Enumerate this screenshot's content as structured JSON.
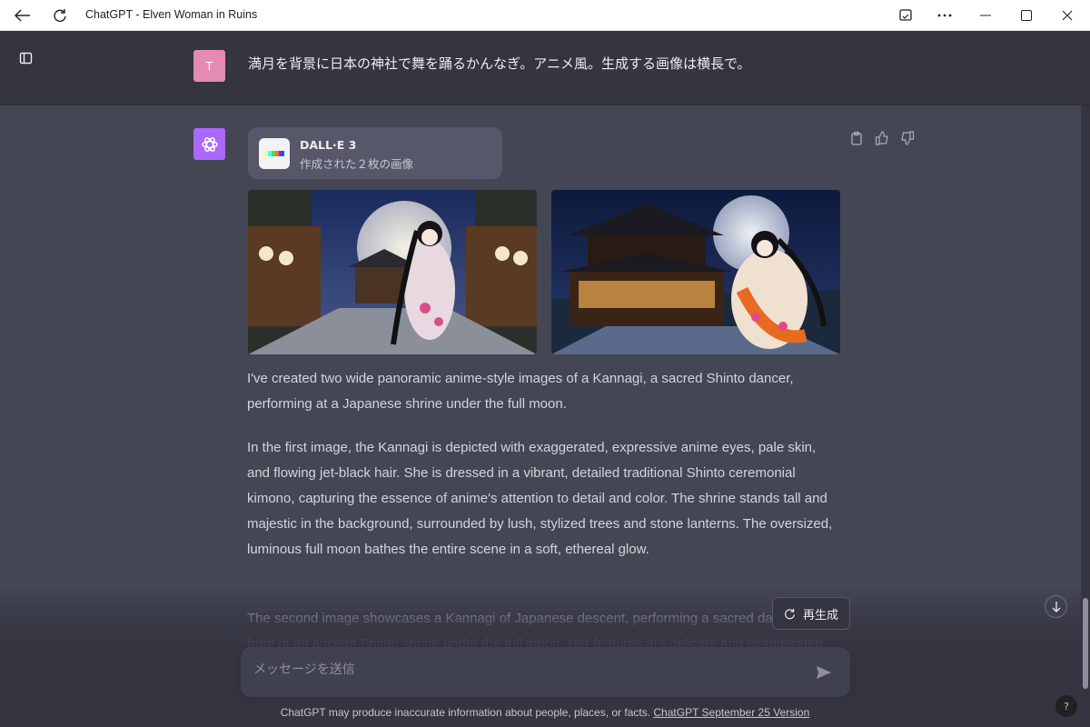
{
  "window": {
    "title": "ChatGPT - Elven Woman in Ruins"
  },
  "user_message": {
    "avatar_initial": "T",
    "text": "満月を背景に日本の神社で舞を踊るかんなぎ。アニメ風。生成する画像は横長で。"
  },
  "assistant": {
    "tool_card": {
      "title": "DALL·E 3",
      "subtitle": "作成された２枚の画像"
    },
    "paragraphs": [
      "I've created two wide panoramic anime-style images of a Kannagi, a sacred Shinto dancer, performing at a Japanese shrine under the full moon.",
      "In the first image, the Kannagi is depicted with exaggerated, expressive anime eyes, pale skin, and flowing jet-black hair. She is dressed in a vibrant, detailed traditional Shinto ceremonial kimono, capturing the essence of anime's attention to detail and color. The shrine stands tall and majestic in the background, surrounded by lush, stylized trees and stone lanterns. The oversized, luminous full moon bathes the entire scene in a soft, ethereal glow.",
      "The second image showcases a Kannagi of Japanese descent, performing a sacred dance in front of an ancient Shinto shrine under the full moon. Her features are delicate and exaggerated"
    ]
  },
  "controls": {
    "regenerate_label": "再生成",
    "composer_placeholder": "メッセージを送信"
  },
  "footer": {
    "disclaimer": "ChatGPT may produce inaccurate information about people, places, or facts. ",
    "version_link": "ChatGPT September 25 Version"
  },
  "help_label": "?",
  "colors": {
    "accent_assistant": "#ab68ff",
    "user_avatar": "#e58ab0",
    "background_user": "#343541",
    "background_assistant": "#444654"
  },
  "icons": {
    "back": "arrow-left-icon",
    "reload": "reload-icon",
    "cast": "cast-icon",
    "more": "more-icon",
    "minimize": "minimize-icon",
    "maximize": "maximize-icon",
    "close": "close-icon",
    "sidebar": "sidebar-toggle-icon",
    "openai": "openai-logo-icon",
    "copy": "clipboard-icon",
    "thumbs_up": "thumbs-up-icon",
    "thumbs_down": "thumbs-down-icon",
    "regenerate": "refresh-icon",
    "send": "send-icon",
    "scroll_down": "arrow-down-icon"
  }
}
